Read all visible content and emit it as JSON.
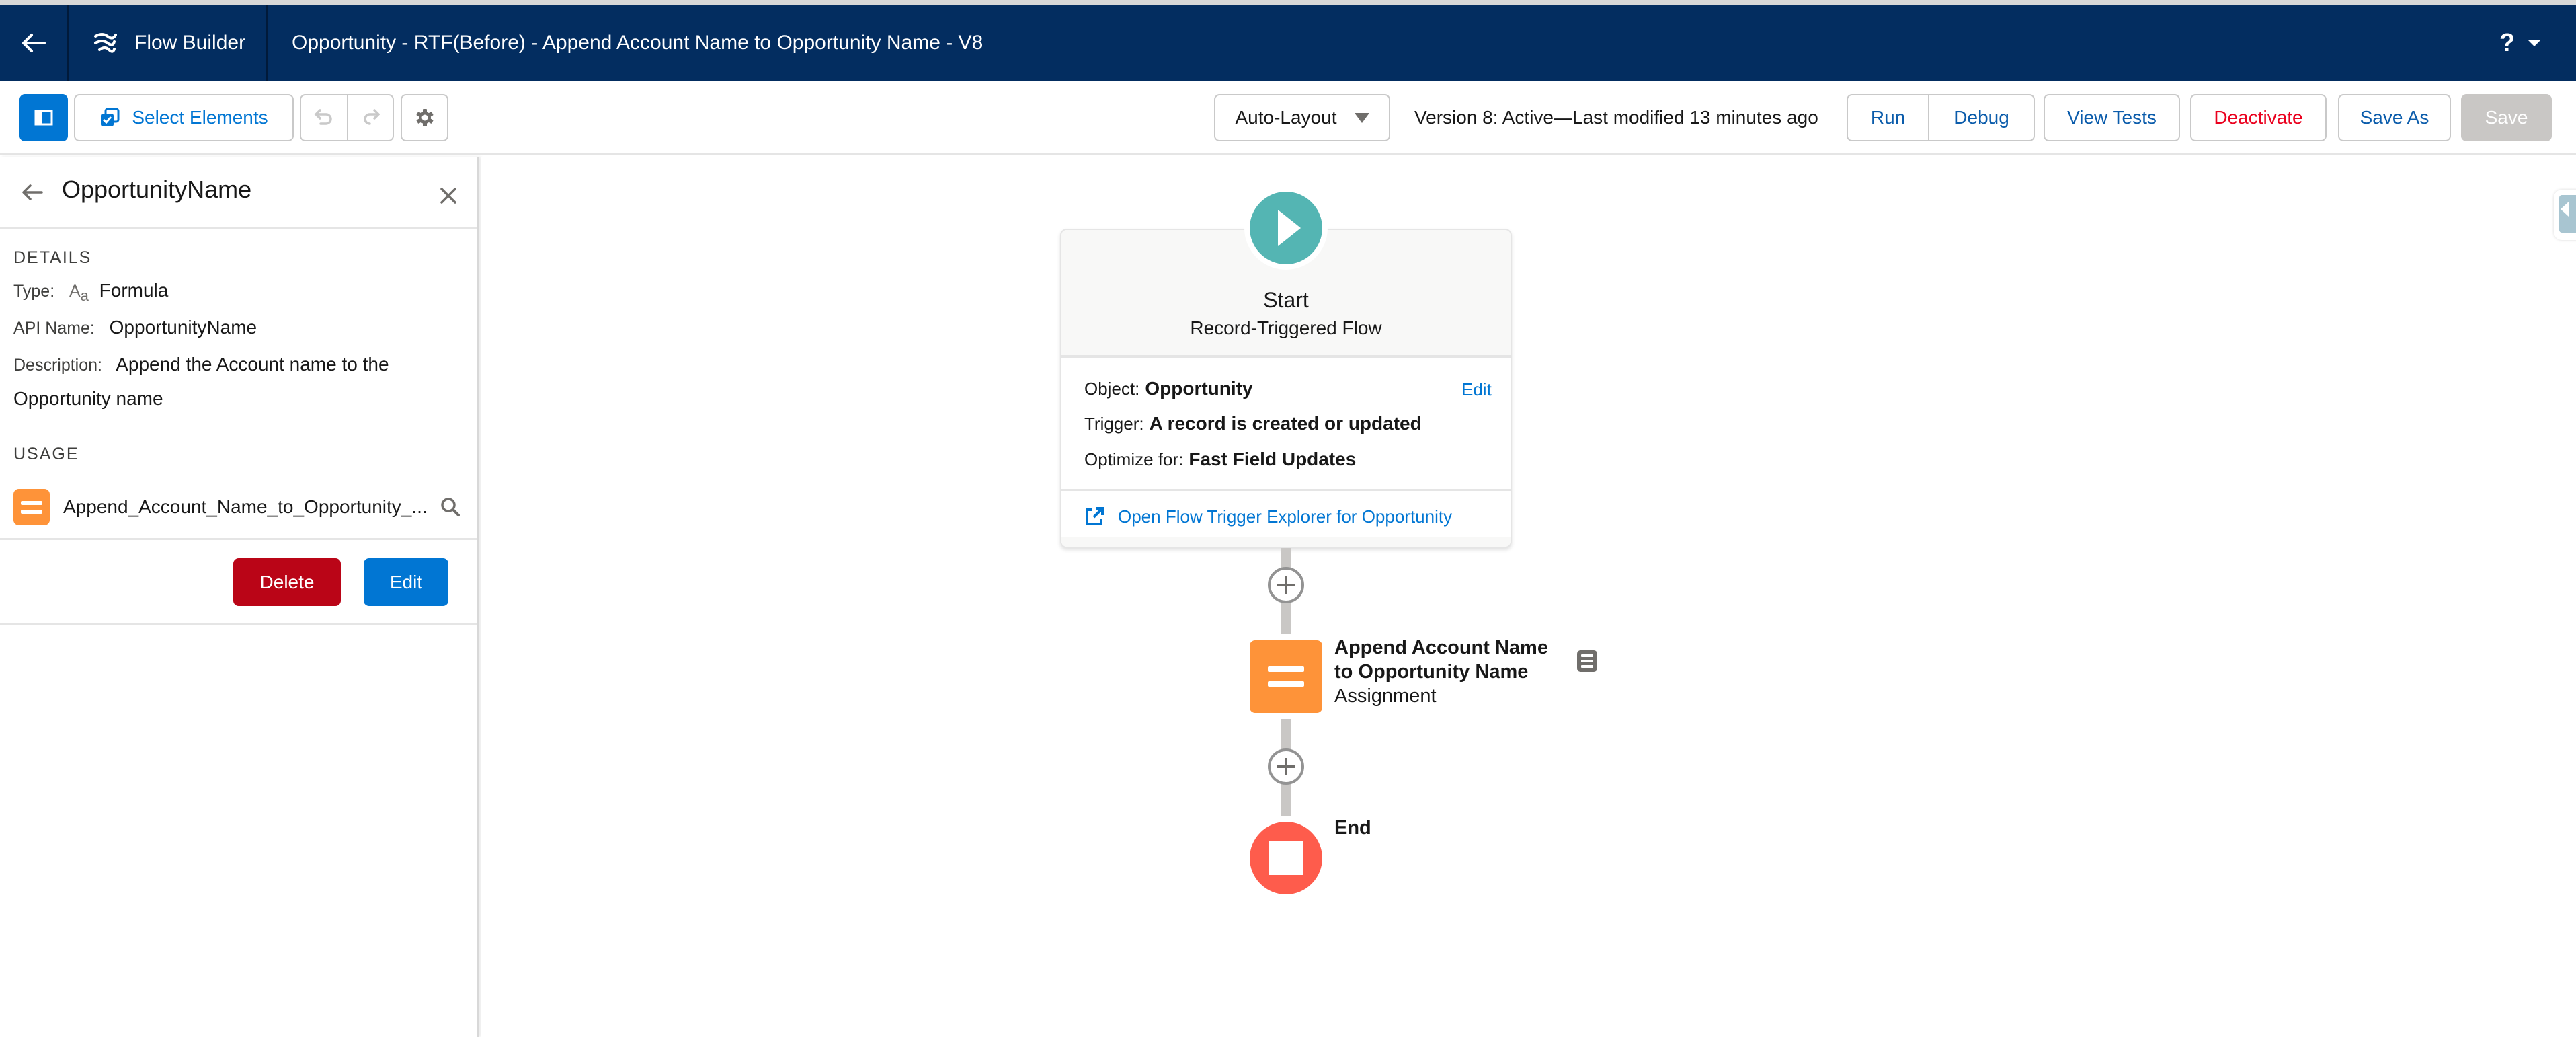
{
  "header": {
    "app_name": "Flow Builder",
    "flow_title": "Opportunity - RTF(Before) - Append Account Name to Opportunity Name - V8",
    "help_label": "?",
    "icons": {
      "back": "arrow-left-icon",
      "app": "flow-icon",
      "help": "help-icon"
    },
    "colors": {
      "background": "#032d60"
    }
  },
  "toolbar": {
    "select_elements_label": "Select Elements",
    "layout_select": {
      "selected": "Auto-Layout"
    },
    "version_status": "Version 8: Active—Last modified 13 minutes ago",
    "run_label": "Run",
    "debug_label": "Debug",
    "view_tests_label": "View Tests",
    "deactivate_label": "Deactivate",
    "save_as_label": "Save As",
    "save_label": "Save",
    "save_disabled": true,
    "undo_disabled": true,
    "redo_disabled": true,
    "colors": {
      "primary": "#0176d3",
      "destructive": "#ea001e",
      "disabled": "#c9c7c5"
    }
  },
  "panel": {
    "title": "OpportunityName",
    "details_heading": "DETAILS",
    "type_label": "Type:",
    "type_icon": "Aa",
    "type_value": "Formula",
    "api_name_label": "API Name:",
    "api_name_value": "OpportunityName",
    "description_label": "Description:",
    "description_value": "Append the Account name to the Opportunity name",
    "usage_heading": "USAGE",
    "usage_items": [
      {
        "icon": "assignment-icon",
        "label": "Append_Account_Name_to_Opportunity_..."
      }
    ],
    "delete_label": "Delete",
    "edit_label": "Edit"
  },
  "canvas": {
    "start": {
      "title": "Start",
      "subtitle": "Record-Triggered Flow",
      "object_label": "Object:",
      "object_value": "Opportunity",
      "trigger_label": "Trigger:",
      "trigger_value": "A record is created or updated",
      "optimize_label": "Optimize for:",
      "optimize_value": "Fast Field Updates",
      "edit_label": "Edit",
      "explorer_link": "Open Flow Trigger Explorer for Opportunity",
      "color": "#54b5b3"
    },
    "assignment": {
      "label_line1": "Append Account Name",
      "label_line2": "to Opportunity Name",
      "type": "Assignment",
      "color": "#fe9339"
    },
    "end": {
      "label": "End",
      "color": "#fe5c4c"
    }
  }
}
